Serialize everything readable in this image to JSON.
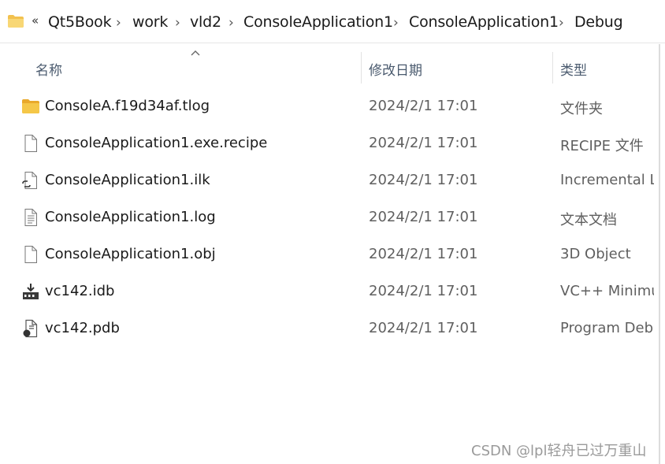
{
  "breadcrumb": {
    "overflow": "«",
    "items": [
      "Qt5Book",
      "work",
      "vld2",
      "ConsoleApplication1",
      "ConsoleApplication1",
      "Debug"
    ],
    "separator": "›"
  },
  "columns": {
    "name": "名称",
    "date": "修改日期",
    "type": "类型"
  },
  "files": [
    {
      "name": "ConsoleA.f19d34af.tlog",
      "date": "2024/2/1 17:01",
      "type": "文件夹",
      "icon": "folder-icon"
    },
    {
      "name": "ConsoleApplication1.exe.recipe",
      "date": "2024/2/1 17:01",
      "type": "RECIPE 文件",
      "icon": "blank-file-icon"
    },
    {
      "name": "ConsoleApplication1.ilk",
      "date": "2024/2/1 17:01",
      "type": "Incremental Linker File",
      "icon": "linker-file-icon"
    },
    {
      "name": "ConsoleApplication1.log",
      "date": "2024/2/1 17:01",
      "type": "文本文档",
      "icon": "text-document-icon"
    },
    {
      "name": "ConsoleApplication1.obj",
      "date": "2024/2/1 17:01",
      "type": "3D Object",
      "icon": "blank-file-icon"
    },
    {
      "name": "vc142.idb",
      "date": "2024/2/1 17:01",
      "type": "VC++ Minimum Rebuild Dependency File",
      "icon": "idb-file-icon"
    },
    {
      "name": "vc142.pdb",
      "date": "2024/2/1 17:01",
      "type": "Program Debug Database",
      "icon": "pdb-file-icon"
    }
  ],
  "watermark": "CSDN @lpl轻舟已过万重山",
  "colors": {
    "folder": "#f2c14e",
    "header_text": "#4a5a6e",
    "secondary_text": "#5f5f5f"
  }
}
